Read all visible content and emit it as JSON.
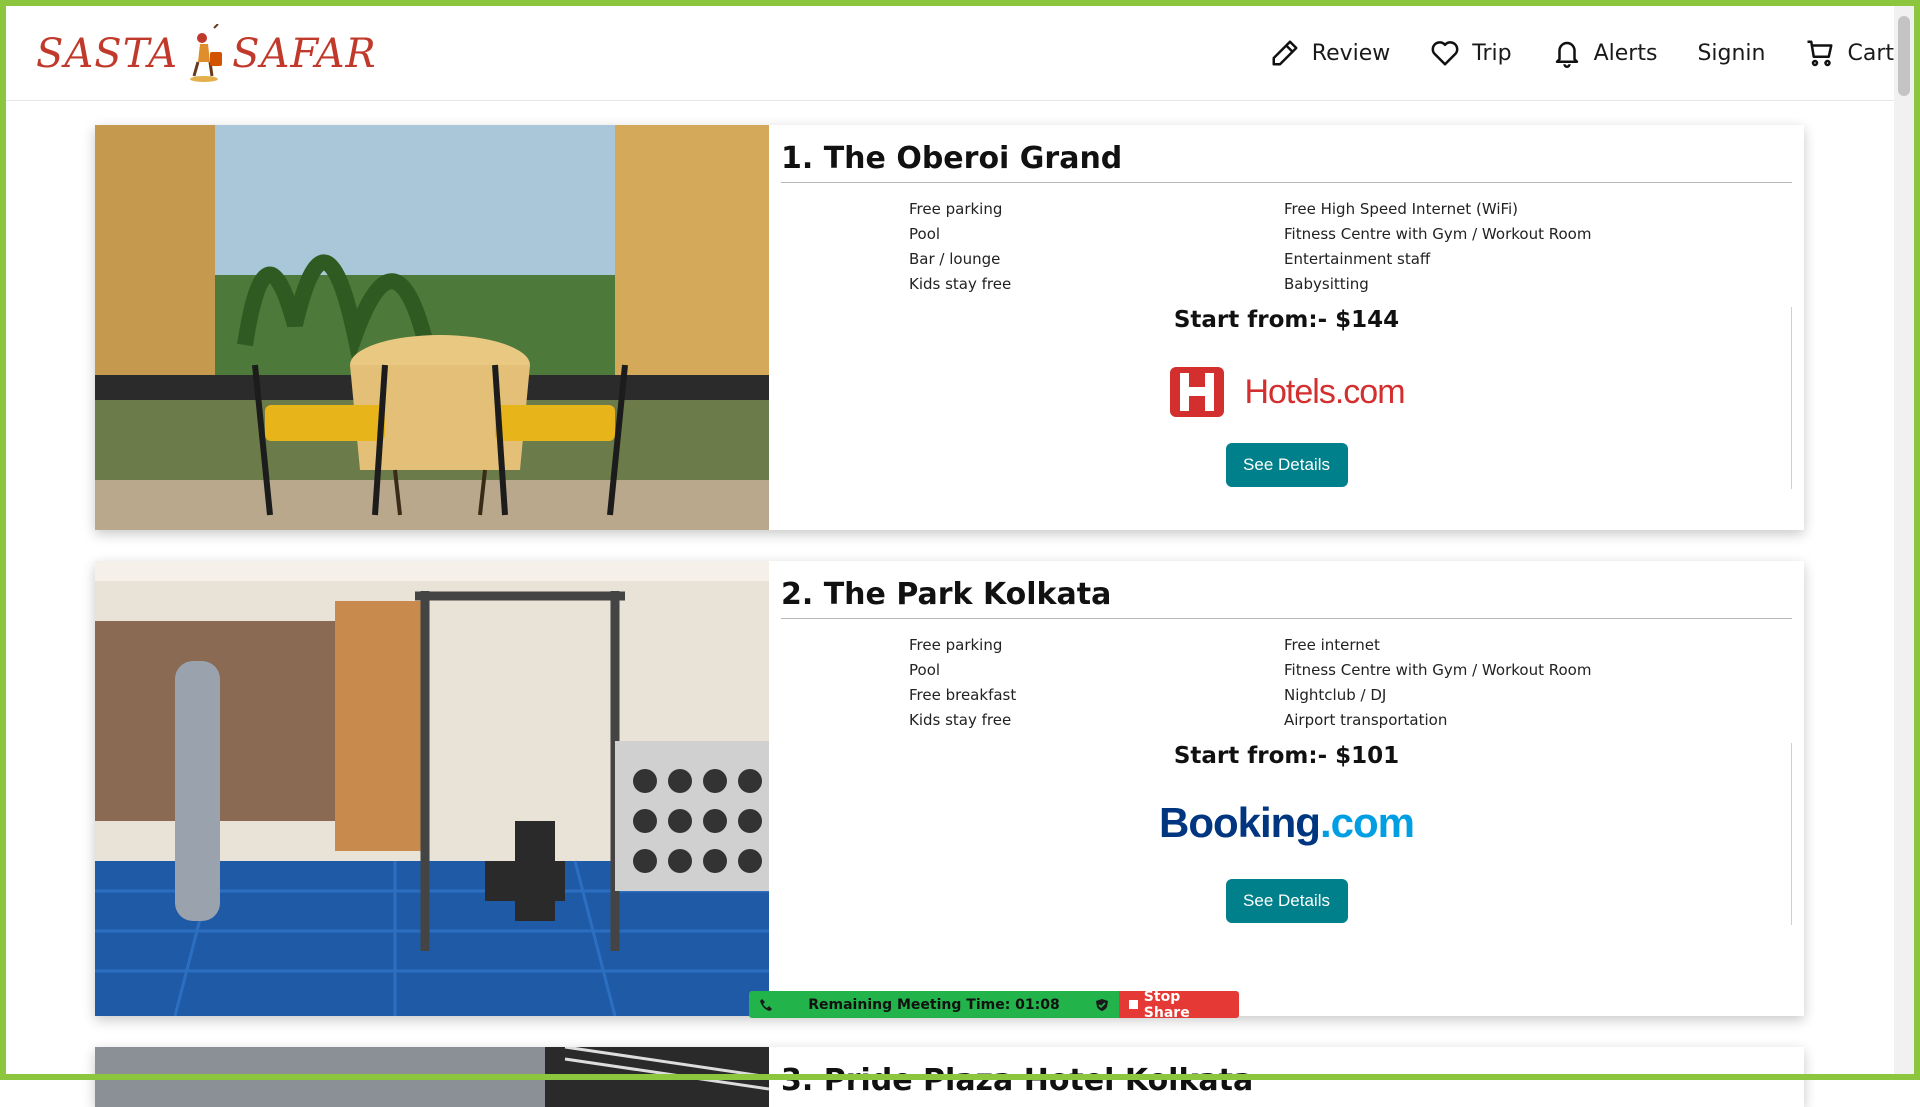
{
  "brand": {
    "logo_left": "SASTA",
    "logo_right": "SAFAR"
  },
  "nav": [
    {
      "label": "Review",
      "icon": "pencil-icon"
    },
    {
      "label": "Trip",
      "icon": "heart-icon"
    },
    {
      "label": "Alerts",
      "icon": "bell-icon"
    },
    {
      "label": "Signin",
      "icon": ""
    },
    {
      "label": "Cart",
      "icon": "cart-icon"
    }
  ],
  "hotels": [
    {
      "title": "1. The Oberoi Grand",
      "amenities_left": [
        "Free parking",
        "Pool",
        "Bar / lounge",
        "Kids stay free"
      ],
      "amenities_right": [
        "Free High Speed Internet (WiFi)",
        "Fitness Centre with Gym / Workout Room",
        "Entertainment staff",
        "Babysitting"
      ],
      "price": "Start from:- $144",
      "partner": "Hotels.com",
      "button": "See Details"
    },
    {
      "title": "2. The Park Kolkata",
      "amenities_left": [
        "Free parking",
        "Pool",
        "Free breakfast",
        "Kids stay free"
      ],
      "amenities_right": [
        "Free internet",
        "Fitness Centre with Gym / Workout Room",
        "Nightclub / DJ",
        "Airport transportation"
      ],
      "price": "Start from:- $101",
      "partner_a": "Booking",
      "partner_b": ".com",
      "button": "See Details"
    },
    {
      "title": "3. Pride Plaza Hotel Kolkata"
    }
  ],
  "meeting": {
    "timer": "Remaining Meeting Time: 01:08",
    "stop": "Stop Share"
  },
  "colors": {
    "frame": "#8cc63f",
    "button": "#00808a",
    "hotels_red": "#d32f2f",
    "booking_dark": "#003580",
    "booking_light": "#009fe3",
    "meeting_green": "#22b34a",
    "meeting_red": "#e53935"
  }
}
